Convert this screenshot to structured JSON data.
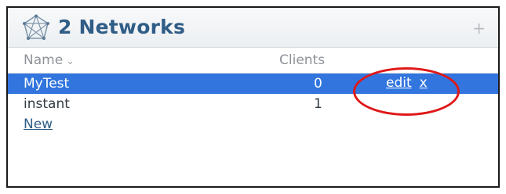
{
  "header": {
    "title": "2 Networks",
    "icon": "network-icon",
    "add_icon": "plus-icon",
    "add_label": "+"
  },
  "columns": {
    "name": "Name",
    "clients": "Clients",
    "sort_indicator": "⌄"
  },
  "rows": [
    {
      "name": "MyTest",
      "clients": "0",
      "edit": "edit",
      "delete": "x",
      "selected": true
    },
    {
      "name": "instant",
      "clients": "1"
    }
  ],
  "new_link": "New",
  "colors": {
    "title": "#2f5d86",
    "selected_row": "#3275de",
    "highlight_circle": "#e01818"
  }
}
